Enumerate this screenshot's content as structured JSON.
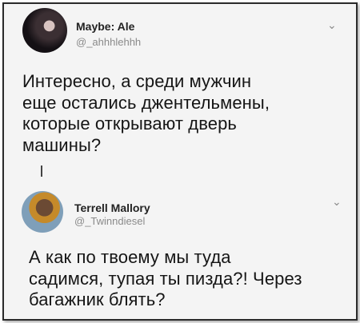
{
  "tweet1": {
    "display_name": "Maybe: Ale",
    "handle": "@_ahhhlehhh",
    "lines": [
      "Интересно, а среди мужчин",
      "еще остались джентельмены,",
      "которые открывают дверь",
      "машины?"
    ]
  },
  "tweet2": {
    "display_name": "Terrell Mallory",
    "handle": "@_Twinndiesel",
    "lines": [
      "А как по твоему мы туда",
      "садимся, тупая ты пизда?! Через",
      "багажник блять?"
    ]
  },
  "icons": {
    "chevron": "chevron-down-icon",
    "avatar1": "avatar",
    "avatar2": "avatar"
  },
  "colors": {
    "background": "#f4f4f4",
    "text": "#151515",
    "muted": "#8a8a8a"
  }
}
